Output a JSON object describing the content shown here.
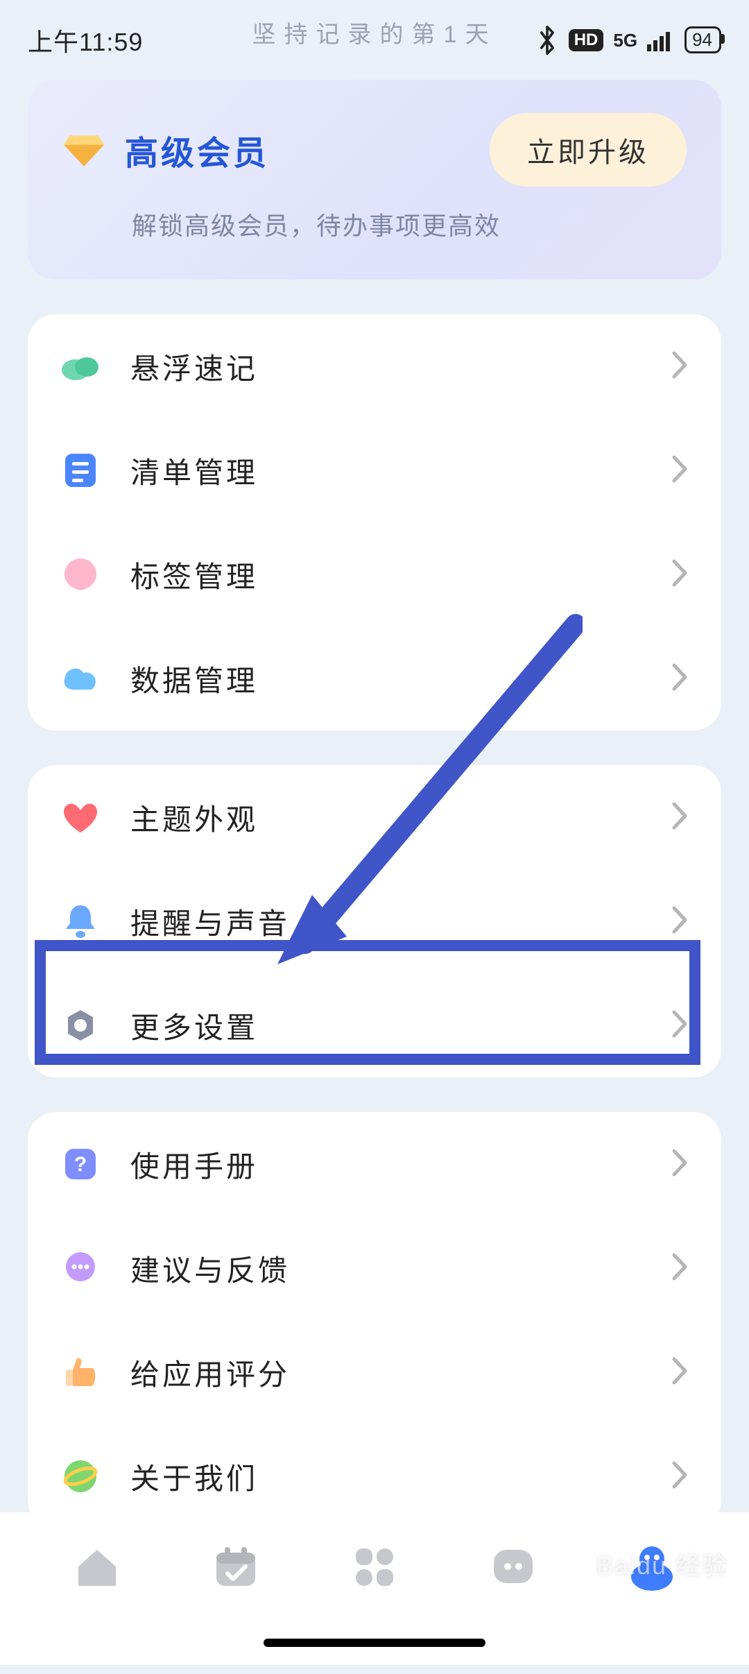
{
  "status_bar": {
    "time": "上午11:59",
    "tagline": "坚持记录的第1天",
    "network": "5G",
    "hd_badge": "HD",
    "battery_pct": "94"
  },
  "premium": {
    "title": "高级会员",
    "subtitle": "解锁高级会员，待办事项更高效",
    "button": "立即升级"
  },
  "groups": [
    {
      "rows": [
        {
          "icon": "cloud-green-icon",
          "label": "悬浮速记"
        },
        {
          "icon": "list-blue-icon",
          "label": "清单管理"
        },
        {
          "icon": "tag-pink-icon",
          "label": "标签管理"
        },
        {
          "icon": "cloud-blue-icon",
          "label": "数据管理"
        }
      ]
    },
    {
      "rows": [
        {
          "icon": "heart-red-icon",
          "label": "主题外观"
        },
        {
          "icon": "bell-blue-icon",
          "label": "提醒与声音"
        },
        {
          "icon": "gear-gray-icon",
          "label": "更多设置"
        }
      ]
    },
    {
      "rows": [
        {
          "icon": "help-blue-icon",
          "label": "使用手册"
        },
        {
          "icon": "chat-purple-icon",
          "label": "建议与反馈"
        },
        {
          "icon": "thumb-orange-icon",
          "label": "给应用评分"
        },
        {
          "icon": "globe-green-icon",
          "label": "关于我们"
        }
      ]
    }
  ],
  "bottom_nav": {
    "items": [
      "home",
      "calendar",
      "grid",
      "chat",
      "profile"
    ],
    "active": "profile"
  },
  "watermark": "Baidu 经验",
  "annotation": {
    "highlight_row_label": "更多设置"
  },
  "colors": {
    "accent_blue": "#2456d6",
    "arrow_blue": "#3f55c8",
    "upgrade_bg": "#fdf1da"
  }
}
